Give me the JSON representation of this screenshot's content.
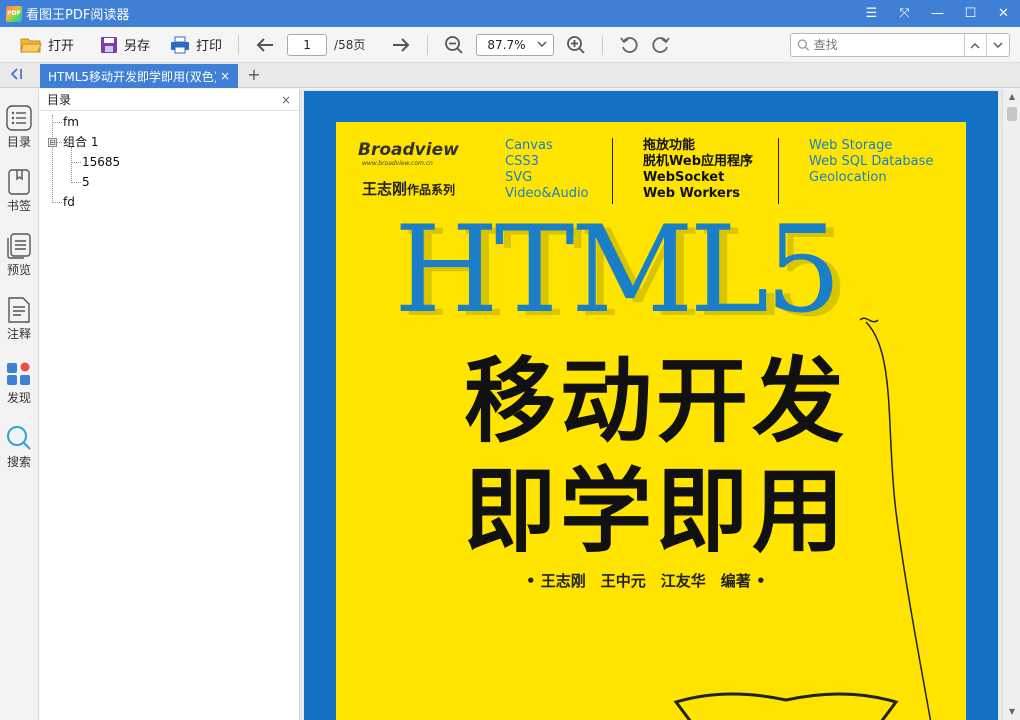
{
  "app": {
    "logo_text": "PDF",
    "title": "看图王PDF阅读器",
    "window_controls": [
      {
        "name": "menu-icon",
        "glyph": "☰"
      },
      {
        "name": "fullscreen-icon",
        "glyph": "⤧"
      },
      {
        "name": "minimize-icon",
        "glyph": "—"
      },
      {
        "name": "maximize-icon",
        "glyph": "☐"
      },
      {
        "name": "close-icon",
        "glyph": "✕"
      }
    ]
  },
  "toolbar": {
    "open_label": "打开",
    "save_as_label": "另存",
    "print_label": "打印",
    "page_current": "1",
    "page_total": "/58页",
    "zoom_value": "87.7%",
    "search_placeholder": "查找"
  },
  "tabs": {
    "active_tab": "HTML5移动开发即学即用(双色)",
    "close_glyph": "×",
    "add_glyph": "+"
  },
  "rail": {
    "items": [
      {
        "label": "目录",
        "icon": "toc-icon"
      },
      {
        "label": "书签",
        "icon": "bookmark-icon"
      },
      {
        "label": "预览",
        "icon": "thumbnails-icon"
      },
      {
        "label": "注释",
        "icon": "annotation-icon"
      },
      {
        "label": "发现",
        "icon": "discover-icon"
      },
      {
        "label": "搜索",
        "icon": "search-icon"
      }
    ]
  },
  "outline": {
    "title": "目录",
    "close_glyph": "×",
    "items": [
      {
        "label": "fm",
        "level": 0
      },
      {
        "label": "组合 1",
        "level": 0,
        "expanded": true,
        "toggle": "⊟"
      },
      {
        "label": "15685",
        "level": 1
      },
      {
        "label": "5",
        "level": 1
      },
      {
        "label": "fd",
        "level": 0
      }
    ]
  },
  "cover": {
    "brand": "Broadview",
    "brand_url": "www.broadview.com.cn",
    "series_name": "王志刚",
    "series_suffix": "作品系列",
    "features_col1": [
      "Canvas",
      "CSS3",
      "SVG",
      "Video&Audio"
    ],
    "features_col2": [
      "拖放功能",
      "脱机Web应用程序",
      "WebSocket",
      "Web Workers"
    ],
    "features_col3": [
      "Web Storage",
      "Web SQL Database",
      "Geolocation"
    ],
    "big_title": "HTML5",
    "zh_title_line1": "移动开发",
    "zh_title_line2": "即学即用",
    "authors": "• 王志刚　王中元　江友华　编著 •",
    "colors": {
      "frame": "#1271c4",
      "background": "#ffe400",
      "accent": "#1b7fc7"
    }
  }
}
